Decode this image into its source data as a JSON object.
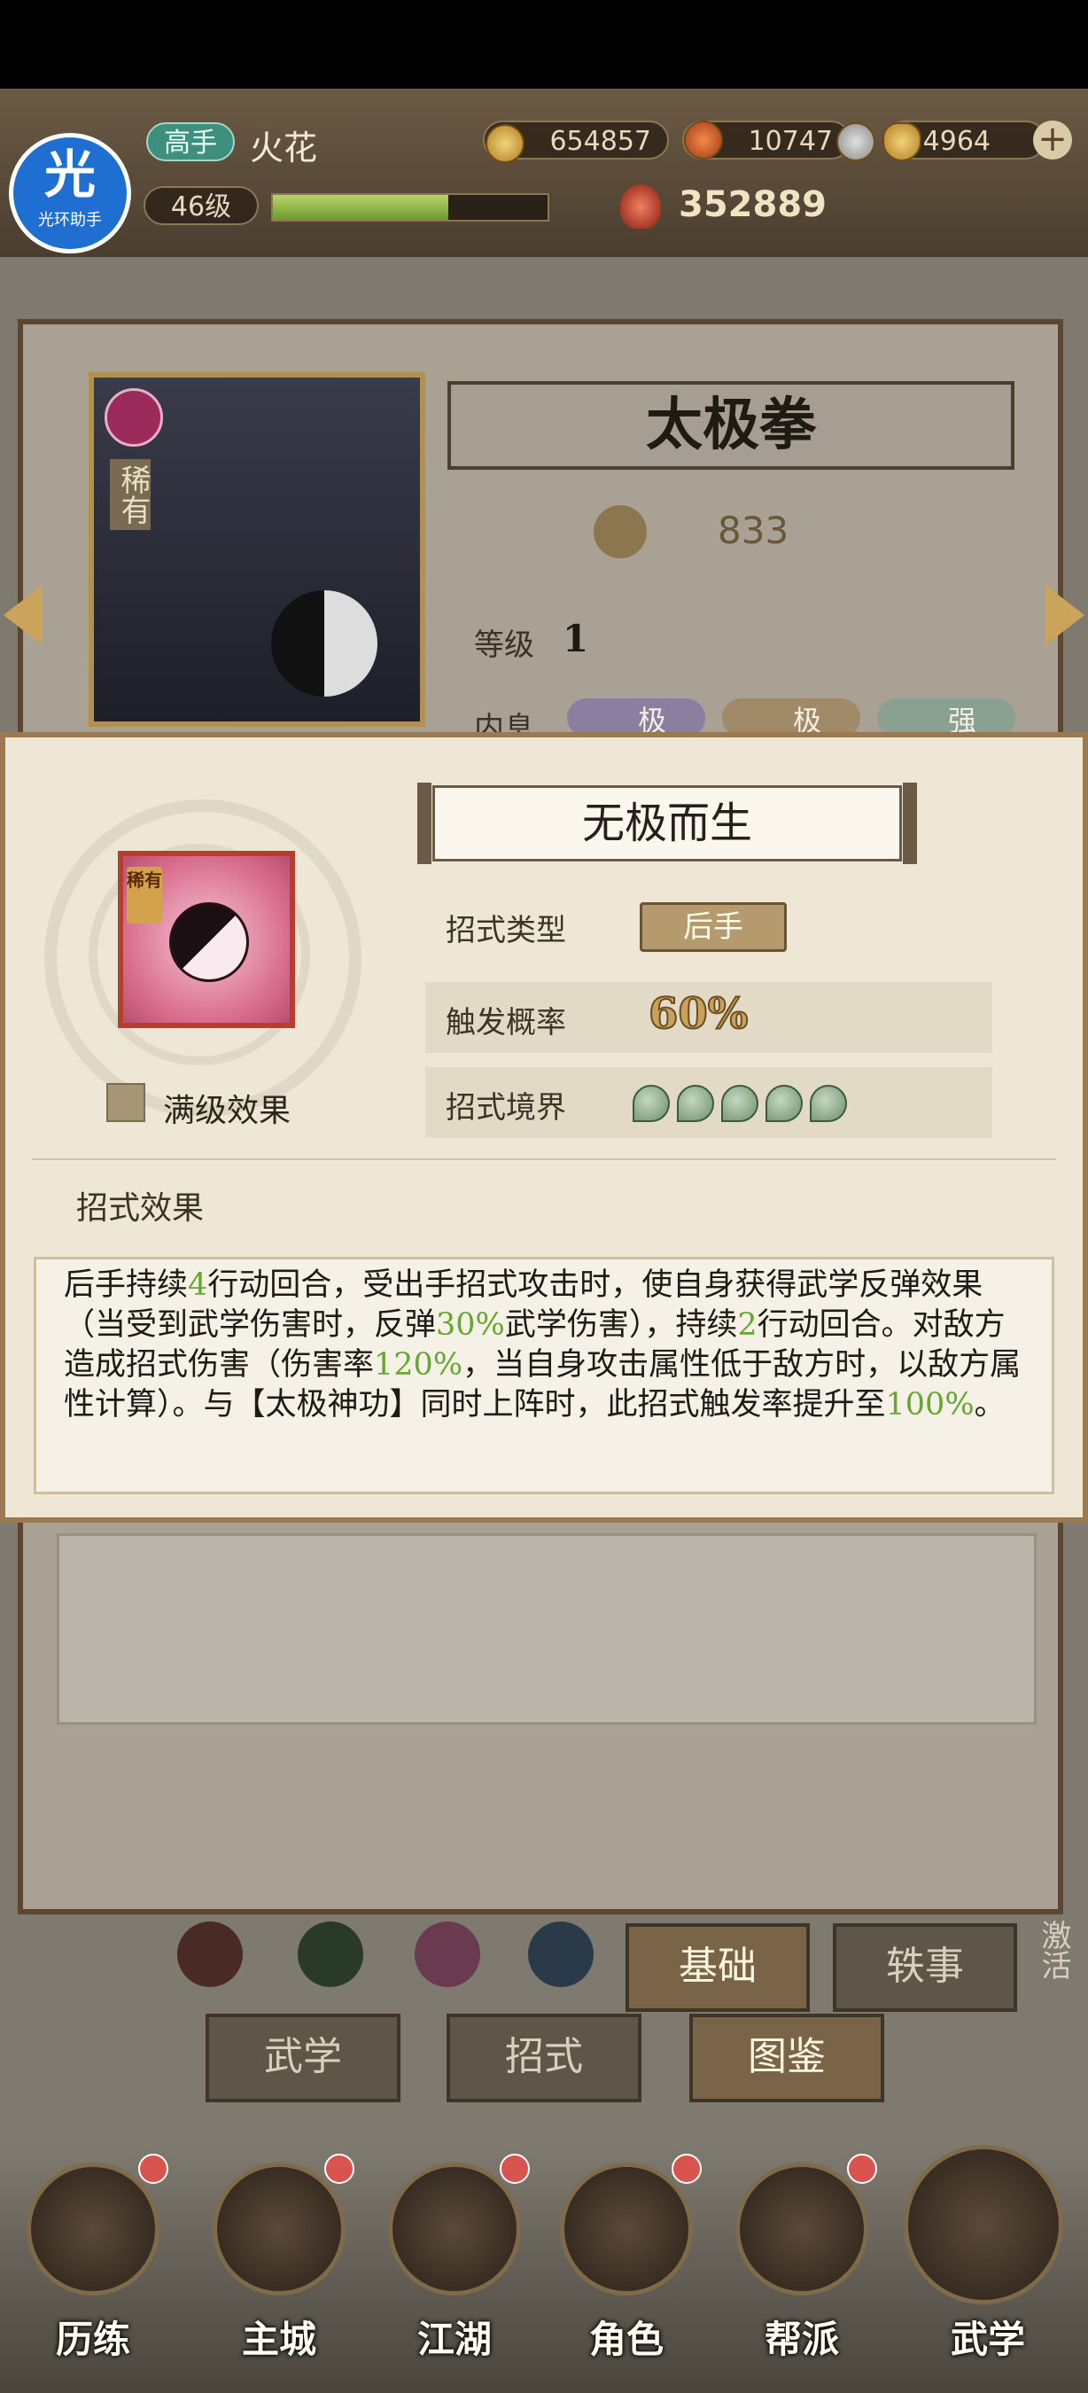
{
  "player": {
    "rank": "高手",
    "name": "火花",
    "level": "46级",
    "copper": "654857",
    "spirit": "10747",
    "gold": "4964",
    "power": "352889",
    "xp_progress": 0.64
  },
  "helper_badge": {
    "glyph": "光",
    "caption": "光环助手"
  },
  "martial_art": {
    "title": "太极拳",
    "rarity": "稀有",
    "score": "833",
    "level_label": "等级",
    "level_value": "1",
    "neigong_label": "内息",
    "traits": [
      "极",
      "极",
      "强"
    ]
  },
  "skill_popup": {
    "name": "无极而生",
    "rarity": "稀有",
    "type_label": "招式类型",
    "type_value": "后手",
    "chance_label": "触发概率",
    "chance_value": "60%",
    "realm_label": "招式境界",
    "realm_count": 5,
    "max_effect_label": "满级效果",
    "effect_header": "招式效果",
    "effect_segments": [
      {
        "text": "后手持续",
        "hl": false
      },
      {
        "text": "4",
        "hl": true
      },
      {
        "text": "行动回合，受出手招式攻击时，使自身获得武学反弹效果（当受到武学伤害时，反弹",
        "hl": false
      },
      {
        "text": "30%",
        "hl": true
      },
      {
        "text": "武学伤害），持续",
        "hl": false
      },
      {
        "text": "2",
        "hl": true
      },
      {
        "text": "行动回合。对敌方造成招式伤害（伤害率",
        "hl": false
      },
      {
        "text": "120%",
        "hl": true
      },
      {
        "text": "，当自身攻击属性低于敌方时，以敌方属性计算）。与【太极神功】同时上阵时，此招式触发率提升至",
        "hl": false
      },
      {
        "text": "100%",
        "hl": true
      },
      {
        "text": "。",
        "hl": false
      }
    ]
  },
  "sub_tabs": {
    "basic": "基础",
    "anecdote": "轶事"
  },
  "side_label": "激活",
  "tabs": {
    "martial": "武学",
    "moves": "招式",
    "atlas": "图鉴"
  },
  "bottom_nav": [
    {
      "label": "历练",
      "icon": "training-icon"
    },
    {
      "label": "主城",
      "icon": "city-icon"
    },
    {
      "label": "江湖",
      "icon": "jianghu-icon"
    },
    {
      "label": "角色",
      "icon": "character-icon"
    },
    {
      "label": "帮派",
      "icon": "guild-icon"
    },
    {
      "label": "武学",
      "icon": "scroll-icon"
    }
  ],
  "colors": {
    "highlight": "#64a830",
    "panel": "#efe7d6",
    "frame": "#9b7a52"
  }
}
